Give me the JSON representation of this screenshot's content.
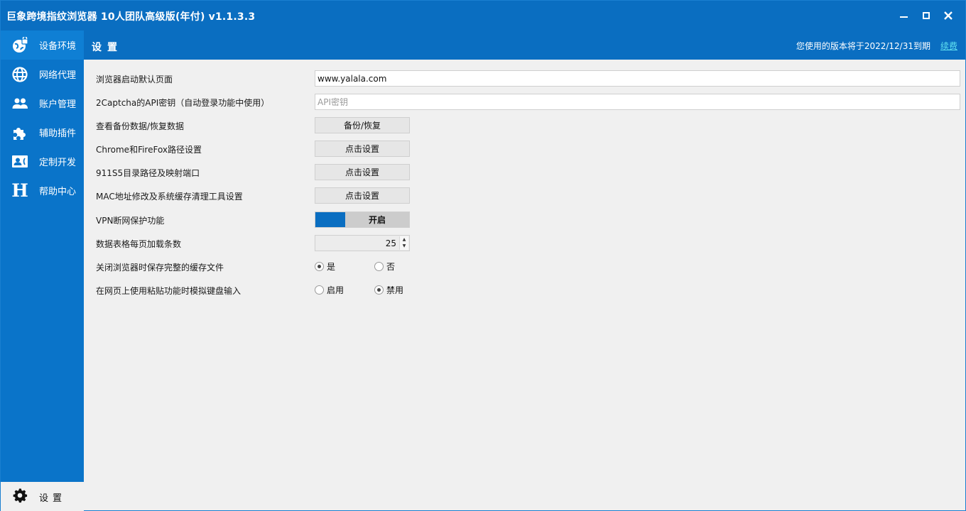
{
  "window": {
    "title": "巨象跨境指纹浏览器 10人团队高级版(年付) v1.1.3.3",
    "controls": {
      "minimize": "minimize-icon",
      "maximize": "maximize-icon",
      "close": "close-icon"
    }
  },
  "sidebar": {
    "items": [
      {
        "label": "设备环境",
        "icon": "globe-lock-icon",
        "active": true
      },
      {
        "label": "网络代理",
        "icon": "globe-icon",
        "active": false
      },
      {
        "label": "账户管理",
        "icon": "users-icon",
        "active": false
      },
      {
        "label": "辅助插件",
        "icon": "puzzle-icon",
        "active": false
      },
      {
        "label": "定制开发",
        "icon": "contact-card-icon",
        "active": false
      },
      {
        "label": "帮助中心",
        "icon": "help-h-icon",
        "active": false
      }
    ],
    "bottom": {
      "label": "设置",
      "icon": "gear-icon"
    }
  },
  "header": {
    "page_title": "设置",
    "expiry_text": "您使用的版本将于2022/12/31到期",
    "renew_link": "续费"
  },
  "settings": {
    "rows": [
      {
        "label": "浏览器启动默认页面",
        "type": "text",
        "value": "www.yalala.com",
        "placeholder": ""
      },
      {
        "label": "2Captcha的API密钥（自动登录功能中使用）",
        "type": "text",
        "value": "",
        "placeholder": "API密钥"
      },
      {
        "label": "查看备份数据/恢复数据",
        "type": "button",
        "button_label": "备份/恢复"
      },
      {
        "label": "Chrome和FireFox路径设置",
        "type": "button",
        "button_label": "点击设置"
      },
      {
        "label": "911S5目录路径及映射端口",
        "type": "button",
        "button_label": "点击设置"
      },
      {
        "label": "MAC地址修改及系统缓存清理工具设置",
        "type": "button",
        "button_label": "点击设置"
      },
      {
        "label": "VPN断网保护功能",
        "type": "toggle",
        "state_label": "开启",
        "on": true
      },
      {
        "label": "数据表格每页加载条数",
        "type": "spinner",
        "value": "25"
      },
      {
        "label": "关闭浏览器时保存完整的缓存文件",
        "type": "radio",
        "options": [
          {
            "label": "是",
            "checked": true
          },
          {
            "label": "否",
            "checked": false
          }
        ]
      },
      {
        "label": "在网页上使用粘贴功能时模拟键盘输入",
        "type": "radio",
        "options": [
          {
            "label": "启用",
            "checked": false
          },
          {
            "label": "禁用",
            "checked": true
          }
        ]
      }
    ]
  },
  "colors": {
    "brand_blue": "#0a6ec1",
    "sidebar_blue": "#0a74c9",
    "active_blue": "#0f7fd4",
    "link_cyan": "#5fe0f0",
    "background": "#f0f0f0"
  }
}
